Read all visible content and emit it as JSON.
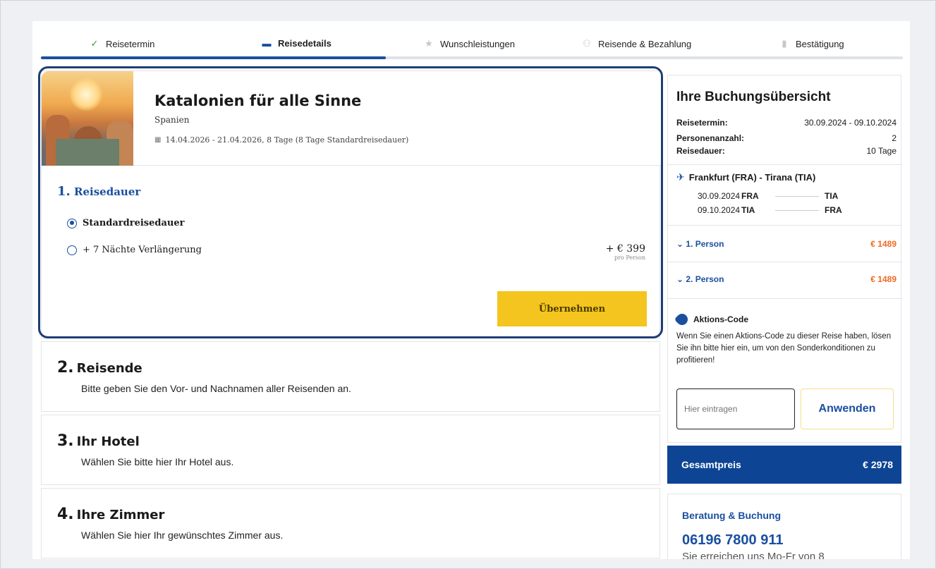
{
  "steps": [
    {
      "label": "Reisetermin",
      "icon": "check-icon"
    },
    {
      "label": "Reisedetails",
      "icon": "bed-icon"
    },
    {
      "label": "Wunschleistungen",
      "icon": "star-icon"
    },
    {
      "label": "Reisende & Bezahlung",
      "icon": "people-icon"
    },
    {
      "label": "Bestätigung",
      "icon": "document-icon"
    }
  ],
  "progress_fraction": 0.4,
  "trip": {
    "title": "Katalonien für alle Sinne",
    "country": "Spanien",
    "dates": "14.04.2026 - 21.04.2026, 8 Tage (8 Tage Standardreisedauer)"
  },
  "duration": {
    "num": "1.",
    "title": "Reisedauer",
    "options": [
      {
        "label": "Standardreisedauer",
        "selected": true
      },
      {
        "label": "+ 7 Nächte Verlängerung",
        "selected": false
      }
    ],
    "extension_price": "+ € 399",
    "extension_unit": "pro Person",
    "apply_label": "Übernehmen"
  },
  "sections": [
    {
      "num": "2.",
      "title": "Reisende",
      "desc": "Bitte geben Sie den Vor- und Nachnamen aller Reisenden an."
    },
    {
      "num": "3.",
      "title": "Ihr Hotel",
      "desc": "Wählen Sie bitte hier Ihr Hotel aus."
    },
    {
      "num": "4.",
      "title": "Ihre Zimmer",
      "desc": "Wählen Sie hier Ihr gewünschtes Zimmer aus."
    }
  ],
  "summary": {
    "title": "Ihre Buchungsübersicht",
    "rows": [
      {
        "k": "Reisetermin:",
        "v": "30.09.2024 - 09.10.2024"
      },
      {
        "k": "Personenanzahl:",
        "v": "2"
      },
      {
        "k": "Reisedauer:",
        "v": "10 Tage"
      }
    ],
    "flight": {
      "title": "Frankfurt (FRA) - Tirana (TIA)",
      "legs": [
        {
          "date": "30.09.2024",
          "from": "FRA",
          "to": "TIA"
        },
        {
          "date": "09.10.2024",
          "from": "TIA",
          "to": "FRA"
        }
      ]
    },
    "persons": [
      {
        "label": "1. Person",
        "price": "€ 1489"
      },
      {
        "label": "2. Person",
        "price": "€ 1489"
      }
    ],
    "promo": {
      "title": "Aktions-Code",
      "text": "Wenn Sie einen Aktions-Code zu dieser Reise haben, lösen Sie ihn bitte hier ein, um von den Sonderkonditionen zu profitieren!",
      "placeholder": "Hier eintragen",
      "button": "Anwenden"
    },
    "total_label": "Gesamtpreis",
    "total_value": "€ 2978"
  },
  "contact": {
    "title": "Beratung & Buchung",
    "phone": "06196 7800 911",
    "hours": "Sie erreichen uns Mo-Fr von 8"
  },
  "colors": {
    "accent": "#1a4fa0",
    "cta": "#f3c51e",
    "price": "#ef6a21",
    "total_bg": "#0d4494"
  }
}
